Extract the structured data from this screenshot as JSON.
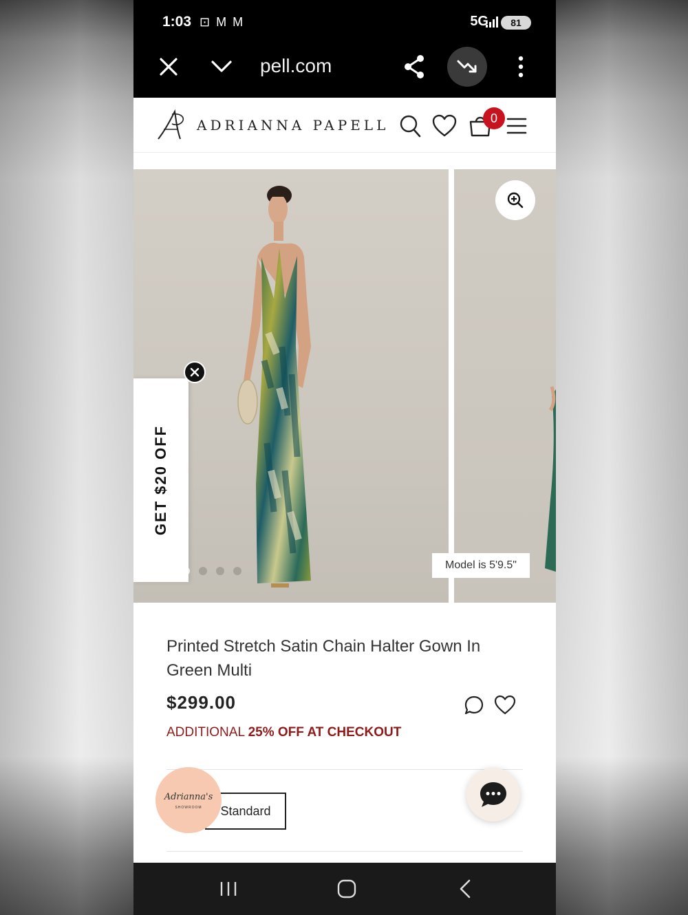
{
  "status_bar": {
    "time": "1:03",
    "notification_icons": "⊡ M M",
    "network": "5G",
    "battery": "81"
  },
  "browser": {
    "url": "pell.com"
  },
  "site": {
    "brand": "ADRIANNA PAPELL",
    "cart_count": "0"
  },
  "gallery": {
    "model_note": "Model is 5'9.5\"",
    "slide_count": 4,
    "active_slide": 1
  },
  "promo_tab": {
    "label": "GET $20 OFF"
  },
  "product": {
    "title": "Printed Stretch Satin Chain Halter Gown In Green Multi",
    "price": "$299.00",
    "promo_prefix": "ADDITIONAL ",
    "promo_bold": "25% OFF AT CHECKOUT",
    "size_option": "Standard"
  },
  "showroom_badge": {
    "script": "Adrianna's",
    "sub": "SHOWROOM"
  },
  "colors": {
    "accent_red": "#c8131e",
    "promo_red": "#8f1a1a",
    "showroom_peach": "#f7c9b0"
  }
}
